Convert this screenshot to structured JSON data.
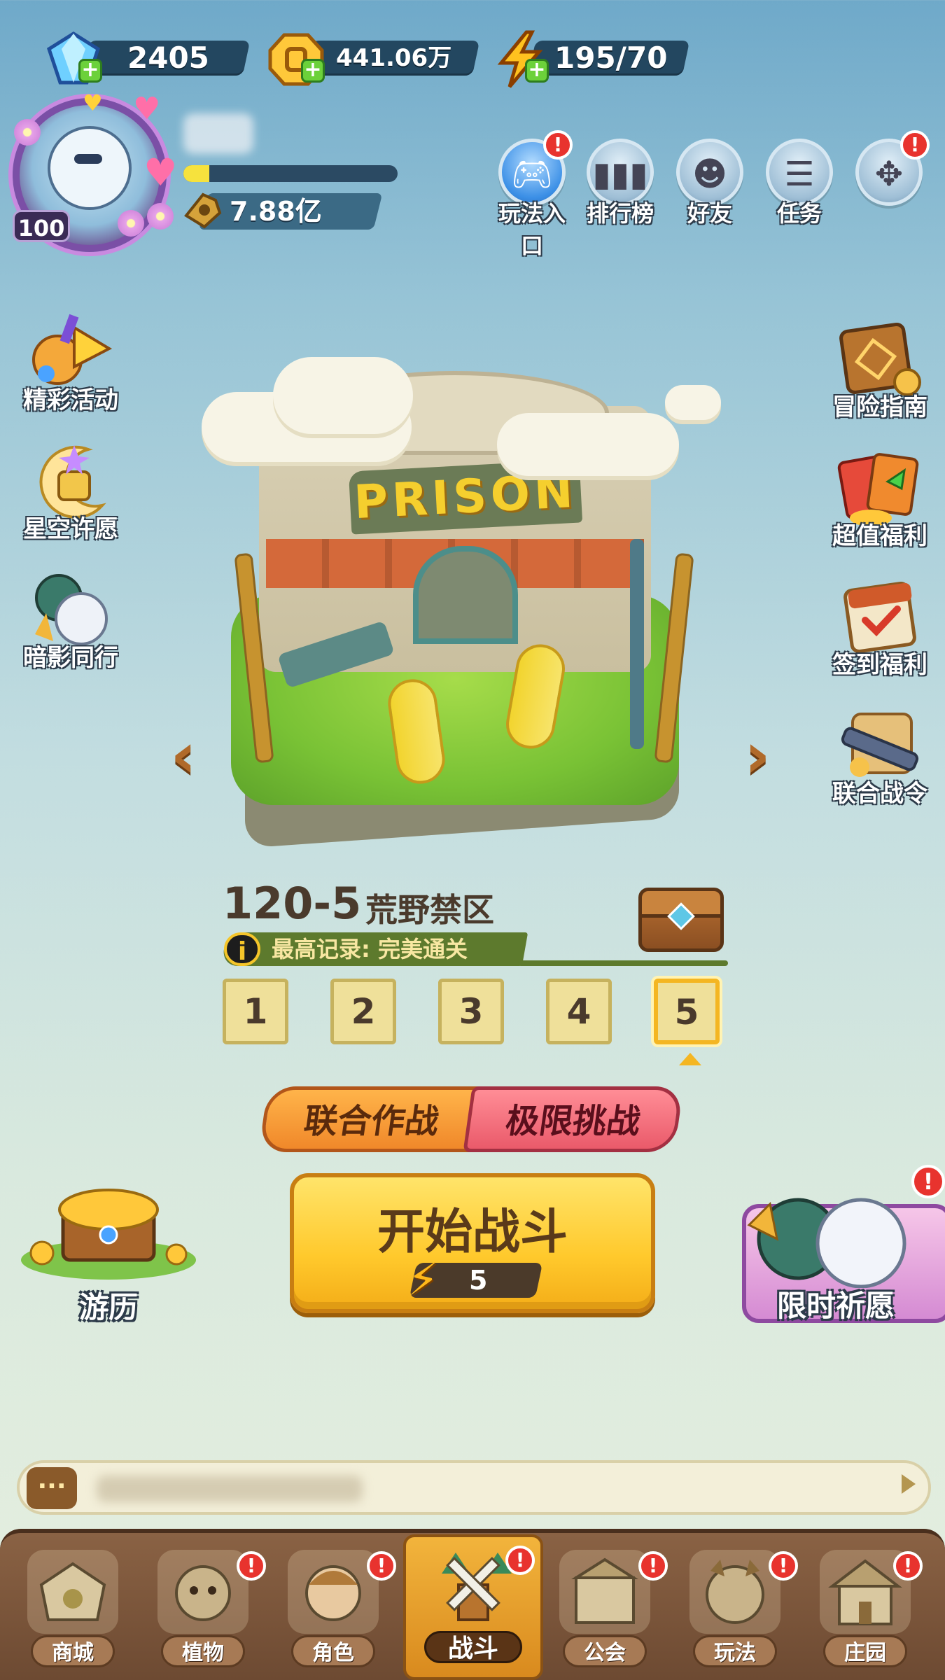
{
  "resources": {
    "diamond": "2405",
    "coin": "441.06万",
    "energy": "195/70"
  },
  "player": {
    "level": "100",
    "power": "7.88亿",
    "xp_fraction": 0.12
  },
  "top_buttons": [
    {
      "id": "play-entry",
      "label": "玩法入口",
      "badge": "!"
    },
    {
      "id": "leaderboard",
      "label": "排行榜"
    },
    {
      "id": "friends",
      "label": "好友"
    },
    {
      "id": "tasks",
      "label": "任务"
    },
    {
      "id": "more",
      "label": "",
      "badge": "!"
    }
  ],
  "left_buttons": [
    {
      "id": "events",
      "label": "精彩活动"
    },
    {
      "id": "starry-wish",
      "label": "星空许愿"
    },
    {
      "id": "shadow-companion",
      "label": "暗影同行"
    }
  ],
  "right_buttons": [
    {
      "id": "adventure-guide",
      "label": "冒险指南"
    },
    {
      "id": "value-benefits",
      "label": "超值福利"
    },
    {
      "id": "checkin-benefits",
      "label": "签到福利"
    },
    {
      "id": "alliance-pass",
      "label": "联合战令"
    }
  ],
  "stage": {
    "sign_text": "PRISON",
    "number": "120-5",
    "name": "荒野禁区",
    "record_icon": "i",
    "record": "最高记录: 完美通关",
    "waves": [
      "1",
      "2",
      "3",
      "4",
      "5"
    ],
    "selected_wave": "5",
    "prev_arrow": "‹",
    "next_arrow": "›"
  },
  "modes": {
    "co_op": "联合作战",
    "extreme": "极限挑战"
  },
  "start": {
    "label": "开始战斗",
    "cost": "5"
  },
  "travel": {
    "label": "游历"
  },
  "limited_wish": {
    "label": "限时祈愿",
    "badge": "!"
  },
  "chat": {
    "icon": "···"
  },
  "nav": [
    {
      "id": "shop",
      "label": "商城"
    },
    {
      "id": "plants",
      "label": "植物",
      "badge": "!"
    },
    {
      "id": "characters",
      "label": "角色",
      "badge": "!"
    },
    {
      "id": "battle",
      "label": "战斗",
      "badge": "!",
      "active": true
    },
    {
      "id": "guild",
      "label": "公会",
      "badge": "!"
    },
    {
      "id": "gameplay",
      "label": "玩法",
      "badge": "!"
    },
    {
      "id": "manor",
      "label": "庄园",
      "badge": "!"
    }
  ],
  "colors": {
    "accent_yellow": "#ffc92c",
    "badge_red": "#e8332e",
    "panel_navy": "#234760"
  }
}
